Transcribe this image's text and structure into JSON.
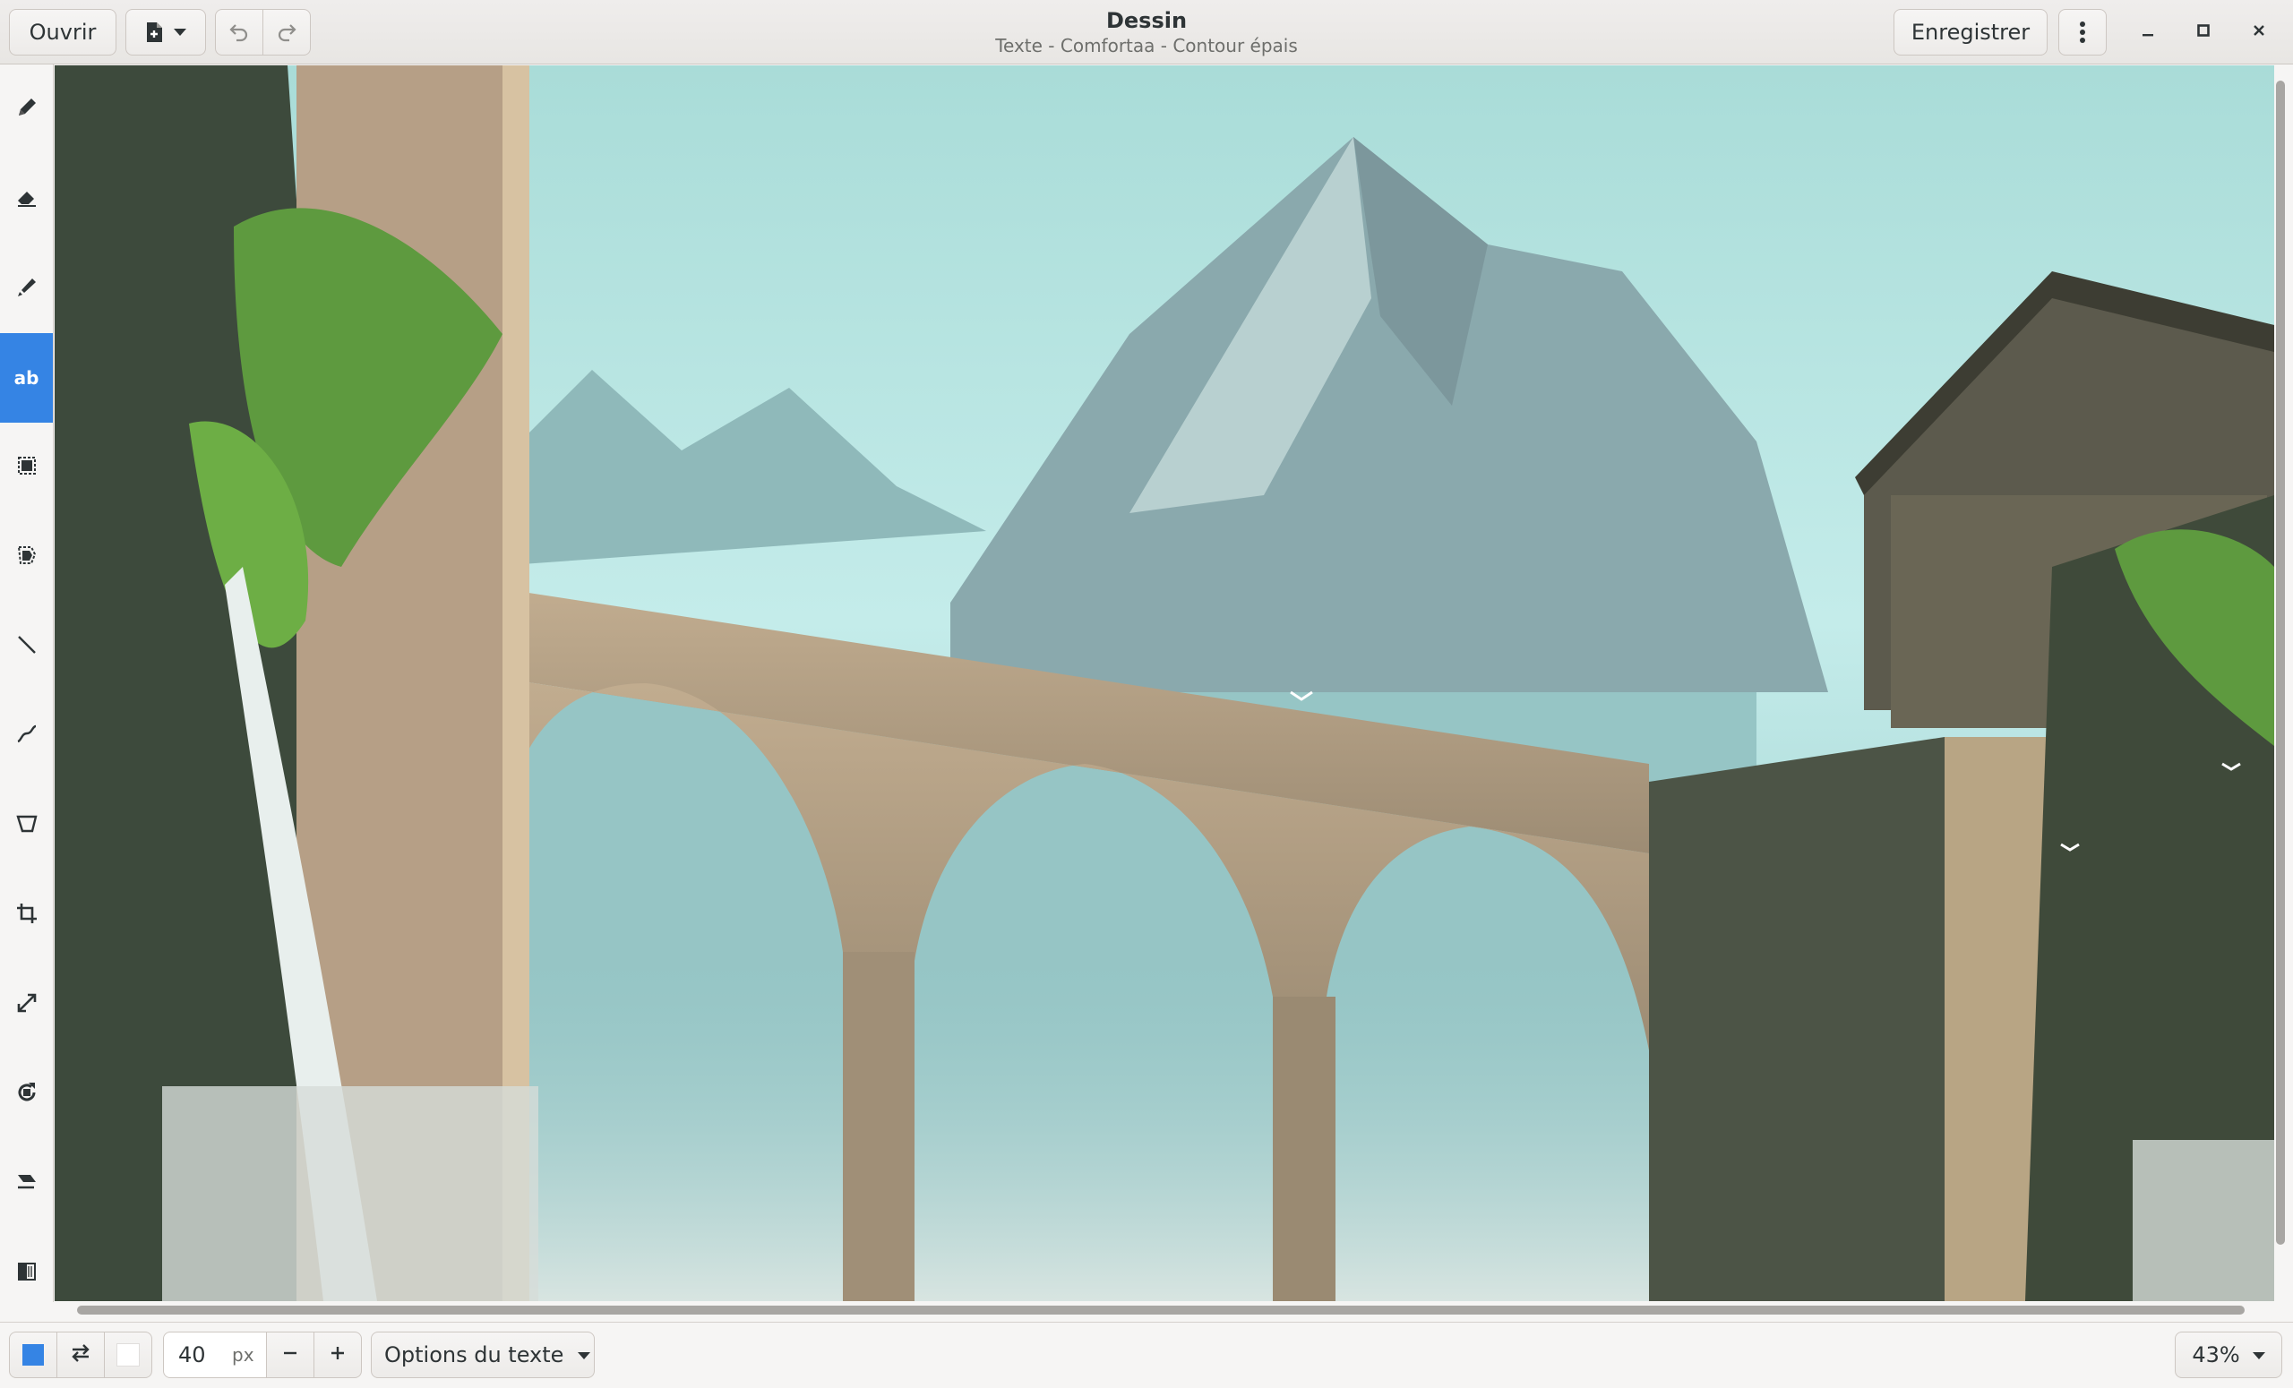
{
  "header": {
    "open_label": "Ouvrir",
    "save_label": "Enregistrer",
    "title": "Dessin",
    "subtitle": "Texte - Comfortaa - Contour épais"
  },
  "tools": [
    {
      "name": "pencil",
      "icon": "pencil-icon"
    },
    {
      "name": "eraser",
      "icon": "eraser-icon"
    },
    {
      "name": "highlighter",
      "icon": "highlighter-icon"
    },
    {
      "name": "text",
      "icon": "text-tool-icon",
      "label": "ab",
      "active": true
    },
    {
      "name": "rect-selection",
      "icon": "rect-select-icon"
    },
    {
      "name": "free-selection",
      "icon": "free-select-icon"
    },
    {
      "name": "line",
      "icon": "line-icon"
    },
    {
      "name": "curve",
      "icon": "curve-icon"
    },
    {
      "name": "shape",
      "icon": "shape-icon"
    },
    {
      "name": "crop",
      "icon": "crop-icon"
    },
    {
      "name": "scale",
      "icon": "scale-icon"
    },
    {
      "name": "rotate",
      "icon": "rotate-icon"
    },
    {
      "name": "skew",
      "icon": "skew-icon"
    },
    {
      "name": "filters",
      "icon": "filters-icon"
    }
  ],
  "colors": {
    "primary": "#3584e4",
    "secondary": "#ffffff"
  },
  "footer": {
    "size_value": "40",
    "size_unit": "px",
    "options_label": "Options du texte",
    "zoom_label": "43%"
  }
}
